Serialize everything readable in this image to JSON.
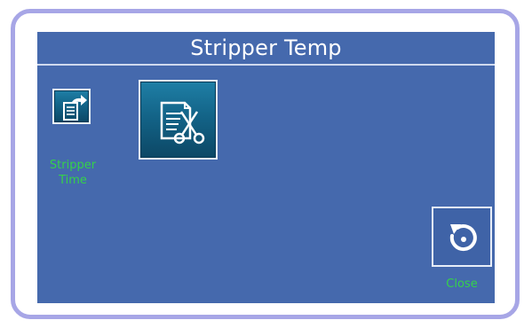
{
  "screen": {
    "title": "Stripper Temp"
  },
  "buttons": {
    "stripper_time": {
      "label_line1": "Stripper",
      "label_line2": "Time",
      "icon": "document-arrow-icon"
    },
    "cut": {
      "icon": "document-scissors-icon"
    },
    "close": {
      "label": "Close",
      "icon": "undo-arrow-icon"
    }
  },
  "colors": {
    "panel_background": "#4569ad",
    "frame_border": "#a7a6e6",
    "label_green": "#35d14a",
    "tile_teal": "#136488"
  }
}
